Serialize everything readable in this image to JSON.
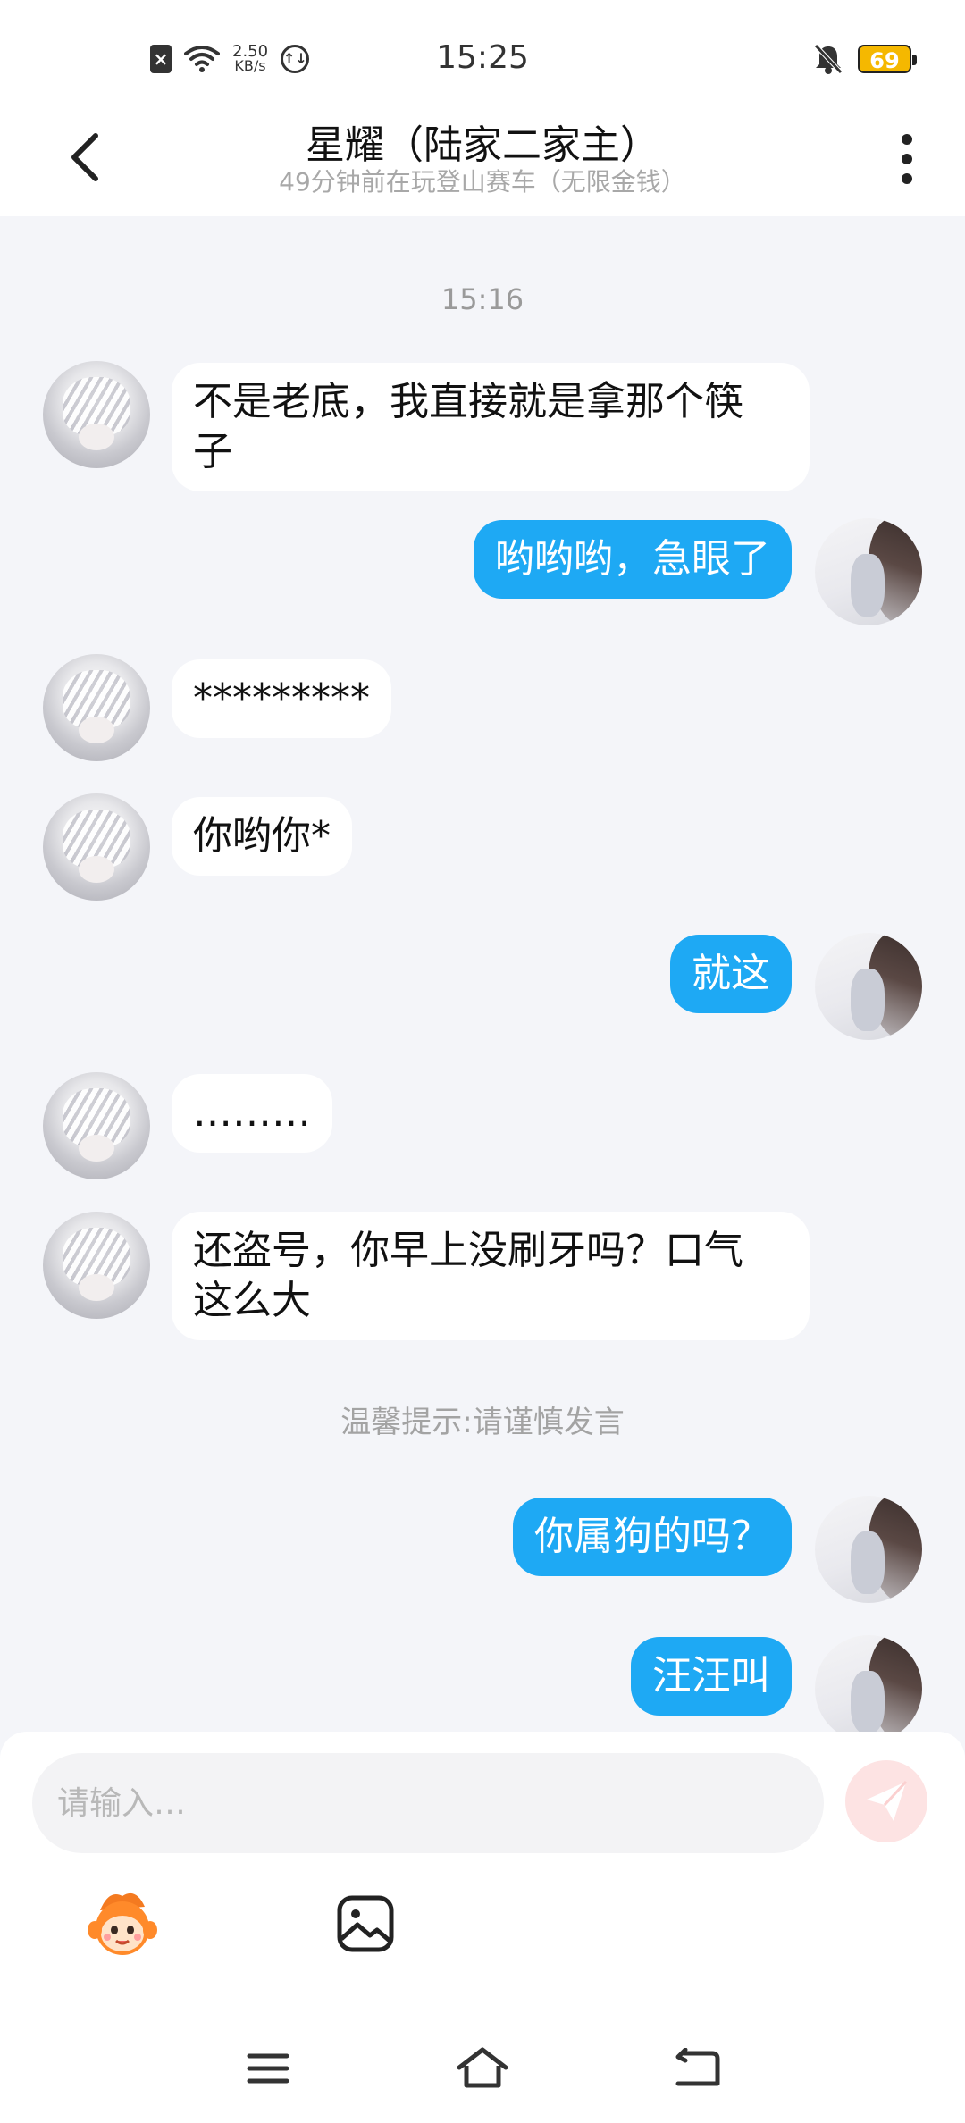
{
  "status_bar": {
    "time": "15:25",
    "net_speed_value": "2.50",
    "net_speed_unit": "KB/s",
    "battery": "69",
    "icons": [
      "sim-disabled-icon",
      "wifi-icon",
      "data-saver-icon",
      "bell-muted-icon",
      "battery-icon"
    ],
    "battery_color": "#f5b800"
  },
  "header": {
    "title": "星耀（陆家二家主）",
    "subtitle": "49分钟前在玩登山赛车（无限金钱）",
    "back_icon": "chevron-left-icon",
    "more_icon": "more-vertical-icon"
  },
  "chat": {
    "timestamp": "15:16",
    "tip": "温馨提示:请谨慎发言",
    "messages": [
      {
        "side": "in",
        "text_lines": [
          "不是老底，我直接就是拿那个筷",
          "子"
        ]
      },
      {
        "side": "out",
        "text": "哟哟哟，急眼了"
      },
      {
        "side": "in",
        "text": "*********"
      },
      {
        "side": "in",
        "text": "你哟你*"
      },
      {
        "side": "out",
        "text": "就这"
      },
      {
        "side": "in",
        "text": "………"
      },
      {
        "side": "in",
        "text_lines": [
          "还盗号，你早上没刷牙吗？口气",
          "这么大"
        ]
      },
      {
        "side": "out",
        "text": "你属狗的吗？"
      },
      {
        "side": "out",
        "text": "汪汪叫"
      }
    ],
    "bubble_out_color": "#1ea9f4",
    "bubble_in_color": "#ffffff"
  },
  "input": {
    "placeholder": "请输入…",
    "value": "",
    "send_icon": "send-icon",
    "emoji_icon": "emoji-mascot-icon",
    "image_icon": "image-icon"
  },
  "nav": {
    "icons": [
      "menu-icon",
      "home-icon",
      "back-icon"
    ]
  }
}
